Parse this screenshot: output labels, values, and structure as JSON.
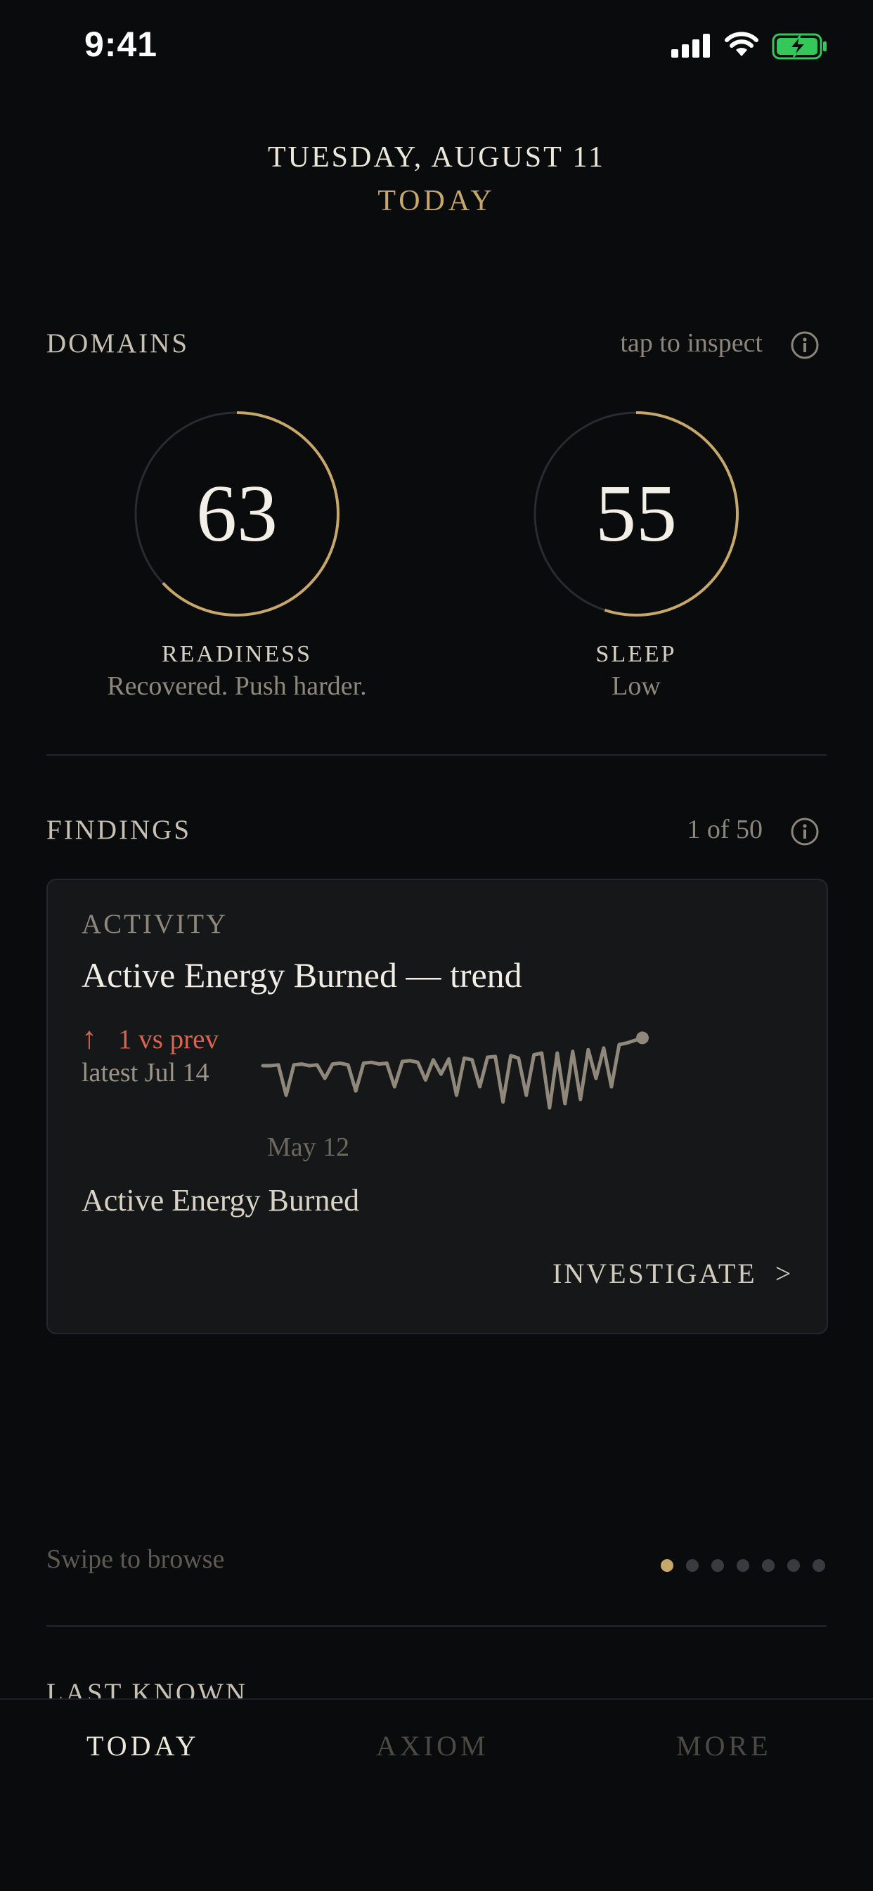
{
  "status_bar": {
    "time": "9:41"
  },
  "header": {
    "date": "TUESDAY, AUGUST 11",
    "subtitle": "TODAY"
  },
  "domains": {
    "title": "DOMAINS",
    "hint": "tap to inspect",
    "rings": [
      {
        "label": "READINESS",
        "value": 63,
        "value_text": "63",
        "subtitle": "Recovered. Push harder.",
        "progress": 0.63
      },
      {
        "label": "SLEEP",
        "value": 55,
        "value_text": "55",
        "subtitle": "Low",
        "progress": 0.55
      }
    ]
  },
  "findings": {
    "title": "FINDINGS",
    "count_text": "1 of 50",
    "card": {
      "category": "ACTIVITY",
      "title": "Active Energy Burned — trend",
      "trend_arrow": "↑",
      "delta_text": "1 vs prev",
      "latest_text": "latest Jul 14",
      "x_start_label": "May 12",
      "metric_name": "Active Energy Burned",
      "action_label": "INVESTIGATE  >",
      "sparkline": [
        0.55,
        0.55,
        0.56,
        0.2,
        0.56,
        0.57,
        0.55,
        0.56,
        0.4,
        0.57,
        0.58,
        0.56,
        0.25,
        0.58,
        0.59,
        0.57,
        0.58,
        0.3,
        0.6,
        0.61,
        0.59,
        0.38,
        0.62,
        0.45,
        0.63,
        0.2,
        0.64,
        0.62,
        0.3,
        0.65,
        0.66,
        0.12,
        0.67,
        0.64,
        0.2,
        0.68,
        0.7,
        0.05,
        0.7,
        0.1,
        0.72,
        0.15,
        0.74,
        0.4,
        0.76,
        0.3,
        0.8,
        0.82,
        0.85,
        0.88
      ]
    }
  },
  "pager": {
    "hint": "Swipe to browse",
    "pages": 7,
    "active_index": 0
  },
  "last_known": {
    "title": "LAST KNOWN"
  },
  "tabs": [
    {
      "label": "TODAY",
      "active": true
    },
    {
      "label": "AXIOM",
      "active": false
    },
    {
      "label": "MORE",
      "active": false
    }
  ],
  "colors": {
    "accent": "#c8a76a",
    "alert": "#d7664f",
    "sparkline": "#8f887b",
    "battery": "#34c759"
  }
}
